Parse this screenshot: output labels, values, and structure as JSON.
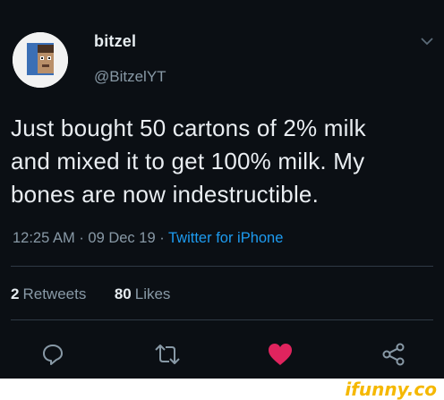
{
  "user": {
    "name": "bitzel",
    "handle": "@BitzelYT"
  },
  "tweet": {
    "text": "Just bought 50 cartons of 2% milk\nand mixed it to get 100% milk. My\nbones are now indestructible.",
    "time": "12:25 AM",
    "date": "09 Dec 19",
    "source": "Twitter for iPhone",
    "separator": "·"
  },
  "stats": {
    "retweets_count": "2",
    "retweets_label": "Retweets",
    "likes_count": "80",
    "likes_label": "Likes"
  },
  "actions": {
    "reply_icon": "reply-icon",
    "retweet_icon": "retweet-icon",
    "like_icon": "heart-icon",
    "share_icon": "share-icon",
    "like_color": "#e0245e"
  },
  "watermark": {
    "logo_text": "ifunny.co",
    "color": "#f5b800"
  }
}
